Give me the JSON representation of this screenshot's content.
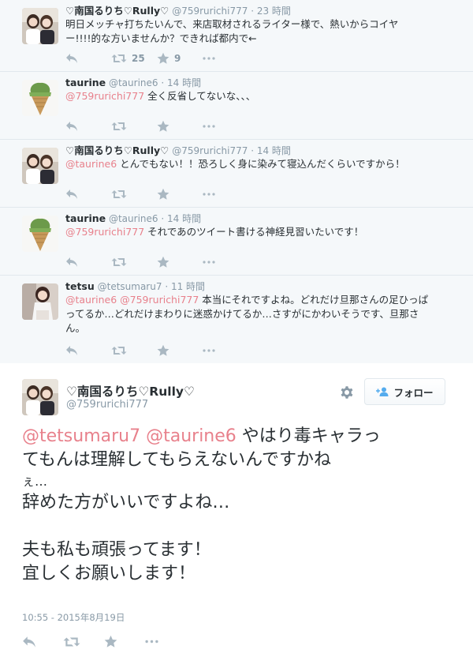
{
  "thread": [
    {
      "name": "♡南国るりち♡Rully♡",
      "handle": "@759rurichi777",
      "dot": "·",
      "time": "23 時間",
      "lines": [
        "明日メッチャ打ちたいんで、来店取材されるライター様で、熱いからコイヤ",
        "ー!!!!的な方いませんか？できれば都内で←"
      ],
      "retweets": "25",
      "favorites": "9",
      "avatar": "person-pair-photo"
    },
    {
      "name": "taurine",
      "handle": "@taurine6",
      "dot": "·",
      "time": "14 時間",
      "mention": "@759rurichi777",
      "text": " 全く反省してないな、、、",
      "avatar": "soft-serve-ice-cream"
    },
    {
      "name": "♡南国るりち♡Rully♡",
      "handle": "@759rurichi777",
      "dot": "·",
      "time": "14 時間",
      "mention": "@taurine6",
      "text": " とんでもない！！恐ろしく身に染みて寝込んだくらいですから！",
      "avatar": "person-pair-photo"
    },
    {
      "name": "taurine",
      "handle": "@taurine6",
      "dot": "·",
      "time": "14 時間",
      "mention": "@759rurichi777",
      "text": " それであのツイート書ける神経見習いたいです！",
      "avatar": "soft-serve-ice-cream"
    },
    {
      "name": "tetsu",
      "handle": "@tetsumaru7",
      "dot": "·",
      "time": "11 時間",
      "mention1": "@taurine6",
      "mention2": "@759rurichi777",
      "line1": " 本当にそれですよね。どれだけ旦那さんの足ひっぱ",
      "line2": "ってるか…どれだけまわりに迷惑かけてるか…さすがにかわいそうです、旦那さ",
      "line3": "ん。",
      "avatar": "woman-photo"
    }
  ],
  "main": {
    "name": "♡南国るりち♡Rully♡",
    "handle": "@759rurichi777",
    "follow_label": "フォロー",
    "mention1": "@tetsumaru7",
    "mention2": "@taurine6",
    "line1_rest": " やはり毒キャラっ",
    "line2": "てもんは理解してもらえないんですかね",
    "line3": "ぇ…",
    "line4": "辞めた方がいいですよね…",
    "line5": "夫も私も頑張ってます！",
    "line6": "宜しくお願いします！",
    "timestamp": "10:55 - 2015年8月19日"
  },
  "colors": {
    "mention": "#e8818c",
    "meta": "#8899a6",
    "icon": "#aab8c2",
    "thread_bg": "#f5f8fa"
  },
  "icons": [
    "reply-icon",
    "retweet-icon",
    "favorite-icon",
    "more-icon",
    "gear-icon",
    "follow-user-icon"
  ]
}
